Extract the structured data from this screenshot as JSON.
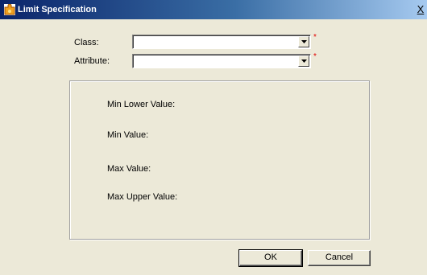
{
  "window": {
    "title": "Limit Specification",
    "close_label": "X",
    "icon": "puzzle-piece-icon",
    "accent": "#0a246a"
  },
  "form": {
    "class_label": "Class:",
    "class_value": "",
    "attribute_label": "Attribute:",
    "attribute_value": "",
    "required_marker": "*",
    "required_color": "#e00000"
  },
  "limits": {
    "min_lower_label": "Min Lower Value:",
    "min_label": "Min Value:",
    "max_label": "Max Value:",
    "max_upper_label": "Max Upper Value:"
  },
  "buttons": {
    "ok_label": "OK",
    "cancel_label": "Cancel"
  }
}
